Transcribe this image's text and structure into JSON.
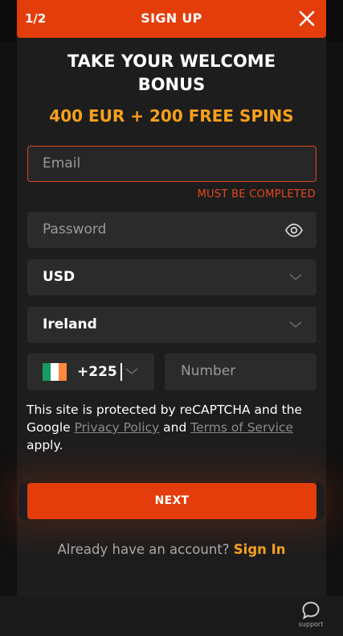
{
  "header": {
    "step": "1/2",
    "title": "SIGN UP",
    "close_icon": "close-icon"
  },
  "promo": {
    "headline_line1": "TAKE YOUR WELCOME",
    "headline_line2": "BONUS",
    "bonus": "400 EUR + 200 FREE SPINS"
  },
  "form": {
    "email": {
      "placeholder": "Email",
      "value": "",
      "error": "MUST BE COMPLETED"
    },
    "password": {
      "placeholder": "Password",
      "value": "",
      "icon": "eye-icon"
    },
    "currency": {
      "selected": "USD",
      "icon": "chevron-down-icon"
    },
    "country": {
      "selected": "Ireland",
      "icon": "chevron-down-icon"
    },
    "phone": {
      "code": "+225",
      "flag": "ireland-flag-icon",
      "flag_colors": [
        "#169b62",
        "#ffffff",
        "#ff883e"
      ],
      "number_placeholder": "Number"
    }
  },
  "legal": {
    "prefix": "This site is protected by reCAPTCHA and the Google ",
    "privacy_link": "Privacy Policy",
    "middle": " and ",
    "terms_link": "Terms of Service",
    "suffix": " apply."
  },
  "actions": {
    "next_label": "NEXT",
    "account_prompt": "Already have an account?",
    "signin_label": "Sign In"
  },
  "support": {
    "label": "support",
    "icon": "chat-bubble-icon"
  },
  "colors": {
    "accent": "#e43d0c",
    "bonus": "#f7a01b",
    "error": "#e5461a",
    "panel": "#1d1d1d",
    "field": "#2b2b2b"
  }
}
